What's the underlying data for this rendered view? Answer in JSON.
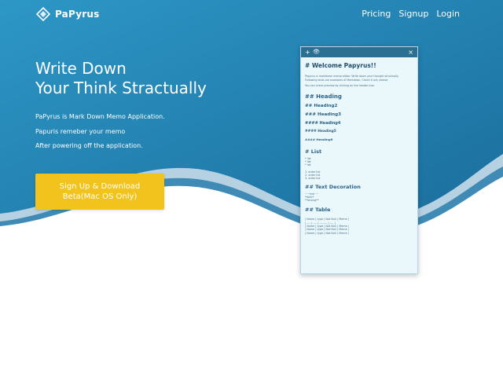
{
  "brand": {
    "name": "PaPyrus"
  },
  "nav": {
    "pricing": "Pricing",
    "signup": "Signup",
    "login": "Login"
  },
  "hero": {
    "headline_1": "Write Down",
    "headline_2": "Your Think Stractually",
    "desc_1": "PaPyrus is Mark Down Memo Application.",
    "desc_2": "Papuris remeber your memo",
    "desc_3": "After powering off the application.",
    "cta_1": "Sign Up & Download",
    "cta_2": "Beta(Mac OS Only)"
  },
  "colors": {
    "hero_top": "#2c93c3",
    "hero_bottom": "#1b6f9e",
    "wave_light": "#b6d2e2",
    "wave_mid": "#3f8bb5",
    "cta": "#f1c31c",
    "window_bar": "#2b6f93"
  },
  "window": {
    "toolbar": {
      "add": "+",
      "preview": "👁",
      "close": "×"
    },
    "title": "# Welcome  Papyrus!!",
    "intro_1": "Papyrus is markdown memo editor. Write down your thought structually.",
    "intro_2": "Following texts are examples of  Markdown. Check it out, please.",
    "intro_3": "You can check preview by clicking on the header icon.",
    "h2": "## Heading",
    "h3": "## Heading2",
    "h4": "### Heading3",
    "h5": "#### Heading4",
    "h6": "#### Heading5",
    "h7": "#### Heading6",
    "list_title": "# List",
    "list_1": "* list",
    "list_2": "* list",
    "list_3": "* list",
    "order_1": "1. order list",
    "order_2": "2. order list",
    "order_3": "3. order list",
    "deco_title": "## Text Decoration",
    "deco_1": "~~line~~",
    "deco_2": "*italic*",
    "deco_3": "**strong**",
    "table_title": "## Table",
    "table_1": "| Name | type | Not Null | Meme |",
    "table_2": "| ---- | ---- | -------- | ---- |",
    "table_3": "| Name | type | Not Null | Meme |",
    "table_4": "| Name | type | Not Null | Meme |",
    "table_5": "| Name | type | Not Null | Meme |"
  }
}
